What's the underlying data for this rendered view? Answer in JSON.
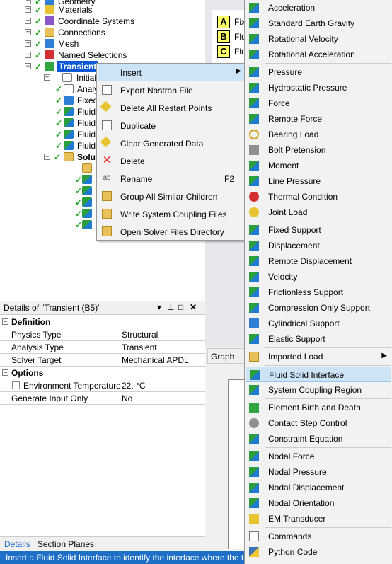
{
  "tree": {
    "items": [
      {
        "label": "Geometry"
      },
      {
        "label": "Materials"
      },
      {
        "label": "Coordinate Systems"
      },
      {
        "label": "Connections"
      },
      {
        "label": "Mesh"
      },
      {
        "label": "Named Selections"
      },
      {
        "label": "Transient"
      },
      {
        "label": "Initial"
      },
      {
        "label": "Analy"
      },
      {
        "label": "Fixed"
      },
      {
        "label": "Fluid S"
      },
      {
        "label": "Fluid S"
      },
      {
        "label": "Fluid S"
      },
      {
        "label": "Fluid S"
      },
      {
        "label": "Solut"
      }
    ]
  },
  "legend": [
    {
      "key": "A",
      "text": "Fix"
    },
    {
      "key": "B",
      "text": "Flu"
    },
    {
      "key": "C",
      "text": "Flu"
    }
  ],
  "context_menu": {
    "items": [
      {
        "label": "Insert",
        "shortcut": ""
      },
      {
        "label": "Export Nastran File",
        "shortcut": ""
      },
      {
        "label": "Delete All Restart Points",
        "shortcut": ""
      },
      {
        "label": "Duplicate",
        "shortcut": ""
      },
      {
        "label": "Clear Generated Data",
        "shortcut": ""
      },
      {
        "label": "Delete",
        "shortcut": ""
      },
      {
        "label": "Rename",
        "shortcut": "F2"
      },
      {
        "label": "Group All Similar Children",
        "shortcut": ""
      },
      {
        "label": "Write System Coupling Files",
        "shortcut": ""
      },
      {
        "label": "Open Solver Files Directory",
        "shortcut": ""
      }
    ]
  },
  "insert_menu": {
    "items": [
      {
        "label": "Acceleration",
        "icon": "acceleration-icon"
      },
      {
        "label": "Standard Earth Gravity",
        "icon": "gravity-icon"
      },
      {
        "label": "Rotational Velocity",
        "icon": "rotational-velocity-icon"
      },
      {
        "label": "Rotational Acceleration",
        "icon": "rotational-acceleration-icon"
      },
      {
        "label": "Pressure",
        "icon": "pressure-icon"
      },
      {
        "label": "Hydrostatic Pressure",
        "icon": "hydrostatic-pressure-icon"
      },
      {
        "label": "Force",
        "icon": "force-icon"
      },
      {
        "label": "Remote Force",
        "icon": "remote-force-icon"
      },
      {
        "label": "Bearing Load",
        "icon": "bearing-load-icon"
      },
      {
        "label": "Bolt Pretension",
        "icon": "bolt-pretension-icon"
      },
      {
        "label": "Moment",
        "icon": "moment-icon"
      },
      {
        "label": "Line Pressure",
        "icon": "line-pressure-icon"
      },
      {
        "label": "Thermal Condition",
        "icon": "thermal-condition-icon"
      },
      {
        "label": "Joint Load",
        "icon": "joint-load-icon"
      },
      {
        "label": "Fixed Support",
        "icon": "fixed-support-icon"
      },
      {
        "label": "Displacement",
        "icon": "displacement-icon"
      },
      {
        "label": "Remote Displacement",
        "icon": "remote-displacement-icon"
      },
      {
        "label": "Velocity",
        "icon": "velocity-icon"
      },
      {
        "label": "Frictionless Support",
        "icon": "frictionless-support-icon"
      },
      {
        "label": "Compression Only Support",
        "icon": "compression-only-support-icon"
      },
      {
        "label": "Cylindrical Support",
        "icon": "cylindrical-support-icon"
      },
      {
        "label": "Elastic Support",
        "icon": "elastic-support-icon"
      },
      {
        "label": "Imported Load",
        "icon": "imported-load-icon"
      },
      {
        "label": "Fluid Solid Interface",
        "icon": "fluid-solid-interface-icon"
      },
      {
        "label": "System Coupling Region",
        "icon": "system-coupling-region-icon"
      },
      {
        "label": "Element Birth and Death",
        "icon": "element-birth-death-icon"
      },
      {
        "label": "Contact Step Control",
        "icon": "contact-step-control-icon"
      },
      {
        "label": "Constraint Equation",
        "icon": "constraint-equation-icon"
      },
      {
        "label": "Nodal Force",
        "icon": "nodal-force-icon"
      },
      {
        "label": "Nodal Pressure",
        "icon": "nodal-pressure-icon"
      },
      {
        "label": "Nodal Displacement",
        "icon": "nodal-displacement-icon"
      },
      {
        "label": "Nodal Orientation",
        "icon": "nodal-orientation-icon"
      },
      {
        "label": "EM Transducer",
        "icon": "em-transducer-icon"
      },
      {
        "label": "Commands",
        "icon": "commands-icon"
      },
      {
        "label": "Python Code",
        "icon": "python-code-icon"
      }
    ]
  },
  "details": {
    "title": "Details of \"Transient (B5)\"",
    "sections": [
      {
        "label": "Definition"
      },
      {
        "label": "Options"
      }
    ],
    "rows": [
      {
        "key": "Physics Type",
        "value": "Structural"
      },
      {
        "key": "Analysis Type",
        "value": "Transient"
      },
      {
        "key": "Solver Target",
        "value": "Mechanical APDL"
      },
      {
        "key": "Environment Temperature",
        "value": "22. °C"
      },
      {
        "key": "Generate Input Only",
        "value": "No"
      }
    ],
    "tabs": [
      "Details",
      "Section Planes"
    ]
  },
  "graph": {
    "label": "Graph"
  },
  "status": {
    "text": "Insert a Fluid Solid Interface to identify the interface where the tr"
  }
}
